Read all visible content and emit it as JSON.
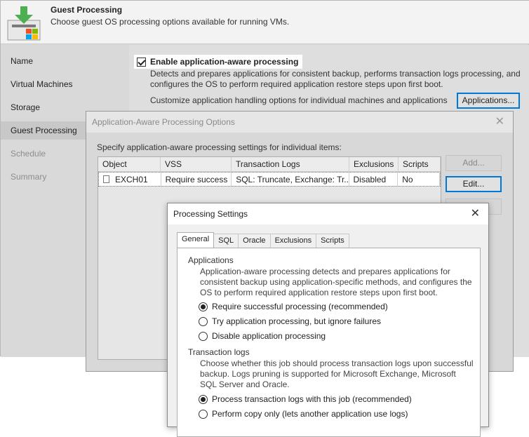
{
  "wizard": {
    "title": "Guest Processing",
    "subtitle": "Choose guest OS processing options available for running VMs.",
    "nav": [
      "Name",
      "Virtual Machines",
      "Storage",
      "Guest Processing",
      "Schedule",
      "Summary"
    ],
    "enable_aap_label": "Enable application-aware processing",
    "enable_aap_checked": true,
    "enable_aap_desc": "Detects and prepares applications for consistent backup, performs transaction logs processing, and configures the OS to perform required application restore steps upon first boot.",
    "customize_label": "Customize application handling options for individual machines and applications",
    "applications_button": "Applications..."
  },
  "aap_dialog": {
    "title": "Application-Aware Processing Options",
    "label": "Specify application-aware processing settings for individual items:",
    "columns": [
      "Object",
      "VSS",
      "Transaction Logs",
      "Exclusions",
      "Scripts"
    ],
    "rows": [
      [
        "EXCH01",
        "Require success",
        "SQL: Truncate, Exchange: Tr...",
        "Disabled",
        "No"
      ]
    ],
    "add_button": "Add...",
    "edit_button": "Edit..."
  },
  "processing_dialog": {
    "title": "Processing Settings",
    "tabs": [
      "General",
      "SQL",
      "Oracle",
      "Exclusions",
      "Scripts"
    ],
    "applications_heading": "Applications",
    "applications_desc": "Application-aware processing detects and prepares applications for consistent backup using application-specific methods, and configures the OS to perform required application restore steps upon first boot.",
    "app_options": [
      "Require successful processing  (recommended)",
      "Try application processing, but ignore failures",
      "Disable application processing"
    ],
    "app_selected": 0,
    "translog_heading": "Transaction logs",
    "translog_desc": "Choose whether this job should process transaction logs upon successful backup. Logs pruning is supported for Microsoft Exchange, Microsoft SQL Server and Oracle.",
    "translog_options": [
      "Process transaction logs with this job (recommended)",
      "Perform copy only (lets another application use logs)"
    ],
    "translog_selected": 0
  }
}
